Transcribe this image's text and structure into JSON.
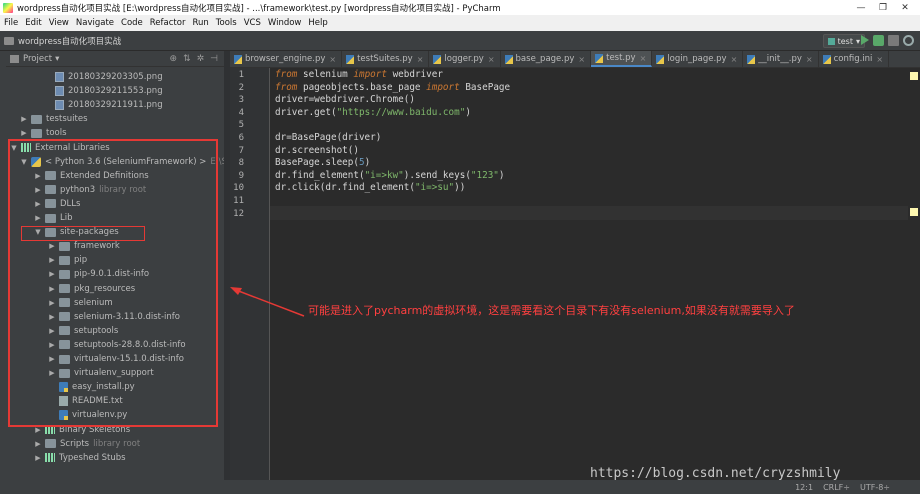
{
  "window": {
    "title": "wordpress自动化项目实战 [E:\\wordpress自动化项目实战] - ...\\framework\\test.py [wordpress自动化项目实战] - PyCharm",
    "controls": [
      "—",
      "❐",
      "✕"
    ]
  },
  "menu": [
    "File",
    "Edit",
    "View",
    "Navigate",
    "Code",
    "Refactor",
    "Run",
    "Tools",
    "VCS",
    "Window",
    "Help"
  ],
  "navbar": {
    "project_crumb": "wordpress自动化项目实战",
    "run_config": "test",
    "run_config_arrow": "▾"
  },
  "project_panel": {
    "title": "Project",
    "title_arrow": "▾",
    "tools": [
      "⊕",
      "⇅",
      "✲",
      "⊣"
    ]
  },
  "tree": [
    {
      "label": "20180329203305.png",
      "muted": "",
      "arrow": "",
      "type": "png",
      "indent": 34
    },
    {
      "label": "20180329211553.png",
      "muted": "",
      "arrow": "",
      "type": "png",
      "indent": 34
    },
    {
      "label": "20180329211911.png",
      "muted": "",
      "arrow": "",
      "type": "png",
      "indent": 34
    },
    {
      "label": "testsuites",
      "muted": "",
      "arrow": "▶",
      "type": "folder",
      "indent": 10
    },
    {
      "label": "tools",
      "muted": "",
      "arrow": "▶",
      "type": "folder",
      "indent": 10
    },
    {
      "label": "External Libraries",
      "muted": "",
      "arrow": "▼",
      "type": "lib",
      "indent": 0
    },
    {
      "label": "< Python 3.6 (SeleniumFramework) >",
      "muted": "E:\\Selenium",
      "arrow": "▼",
      "type": "python",
      "indent": 10
    },
    {
      "label": "Extended Definitions",
      "muted": "",
      "arrow": "▶",
      "type": "folder",
      "indent": 24
    },
    {
      "label": "python3",
      "muted": "library root",
      "arrow": "▶",
      "type": "folder",
      "indent": 24
    },
    {
      "label": "DLLs",
      "muted": "",
      "arrow": "▶",
      "type": "folder",
      "indent": 24
    },
    {
      "label": "Lib",
      "muted": "",
      "arrow": "▶",
      "type": "folder",
      "indent": 24
    },
    {
      "label": "site-packages",
      "muted": "",
      "arrow": "▼",
      "type": "folder",
      "indent": 24
    },
    {
      "label": "framework",
      "muted": "",
      "arrow": "▶",
      "type": "folder",
      "indent": 38
    },
    {
      "label": "pip",
      "muted": "",
      "arrow": "▶",
      "type": "folder",
      "indent": 38
    },
    {
      "label": "pip-9.0.1.dist-info",
      "muted": "",
      "arrow": "▶",
      "type": "folder",
      "indent": 38
    },
    {
      "label": "pkg_resources",
      "muted": "",
      "arrow": "▶",
      "type": "folder",
      "indent": 38
    },
    {
      "label": "selenium",
      "muted": "",
      "arrow": "▶",
      "type": "folder",
      "indent": 38
    },
    {
      "label": "selenium-3.11.0.dist-info",
      "muted": "",
      "arrow": "▶",
      "type": "folder",
      "indent": 38
    },
    {
      "label": "setuptools",
      "muted": "",
      "arrow": "▶",
      "type": "folder",
      "indent": 38
    },
    {
      "label": "setuptools-28.8.0.dist-info",
      "muted": "",
      "arrow": "▶",
      "type": "folder",
      "indent": 38
    },
    {
      "label": "virtualenv-15.1.0.dist-info",
      "muted": "",
      "arrow": "▶",
      "type": "folder",
      "indent": 38
    },
    {
      "label": "virtualenv_support",
      "muted": "",
      "arrow": "▶",
      "type": "folder",
      "indent": 38
    },
    {
      "label": "easy_install.py",
      "muted": "",
      "arrow": "",
      "type": "py",
      "indent": 38
    },
    {
      "label": "README.txt",
      "muted": "",
      "arrow": "",
      "type": "txt",
      "indent": 38
    },
    {
      "label": "virtualenv.py",
      "muted": "",
      "arrow": "",
      "type": "py",
      "indent": 38
    },
    {
      "label": "Binary Skeletons",
      "muted": "",
      "arrow": "▶",
      "type": "lib",
      "indent": 24
    },
    {
      "label": "Scripts",
      "muted": "library root",
      "arrow": "▶",
      "type": "folder",
      "indent": 24
    },
    {
      "label": "Typeshed Stubs",
      "muted": "",
      "arrow": "▶",
      "type": "lib",
      "indent": 24
    }
  ],
  "tabs": [
    {
      "label": "browser_engine.py",
      "active": false
    },
    {
      "label": "testSuites.py",
      "active": false
    },
    {
      "label": "logger.py",
      "active": false
    },
    {
      "label": "base_page.py",
      "active": false
    },
    {
      "label": "test.py",
      "active": true
    },
    {
      "label": "login_page.py",
      "active": false
    },
    {
      "label": "__init__.py",
      "active": false
    },
    {
      "label": "config.ini",
      "active": false
    }
  ],
  "code_lines": [
    [
      [
        "kw",
        "from"
      ],
      [
        "id",
        " selenium "
      ],
      [
        "kw",
        "import"
      ],
      [
        "id",
        " webdriver"
      ]
    ],
    [
      [
        "kw",
        "from"
      ],
      [
        "id",
        " pageobjects.base_page "
      ],
      [
        "kw",
        "import"
      ],
      [
        "id",
        " BasePage"
      ]
    ],
    [
      [
        "id",
        "driver=webdriver.Chrome()"
      ]
    ],
    [
      [
        "id",
        "driver.get("
      ],
      [
        "st",
        "\"https://www.baidu.com\""
      ],
      [
        "id",
        ")"
      ]
    ],
    [],
    [
      [
        "id",
        "dr=BasePage(driver)"
      ]
    ],
    [
      [
        "id",
        "dr.screenshot()"
      ]
    ],
    [
      [
        "id",
        "BasePage.sleep("
      ],
      [
        "nm",
        "5"
      ],
      [
        "id",
        ")"
      ]
    ],
    [
      [
        "id",
        "dr.find_element("
      ],
      [
        "st",
        "\"i=>kw\""
      ],
      [
        "id",
        ").send_keys("
      ],
      [
        "st",
        "\"123\""
      ],
      [
        "id",
        ")"
      ]
    ],
    [
      [
        "id",
        "dr.click(dr.find_element("
      ],
      [
        "st",
        "\"i=>su\""
      ],
      [
        "id",
        "))"
      ]
    ],
    [],
    []
  ],
  "annotation": "可能是进入了pycharm的虚拟环境，这是需要看这个目录下有没有selenium,如果没有就需要导入了",
  "watermark": "https://blog.csdn.net/cryzshmily",
  "status": {
    "position": "12:1",
    "line_sep": "CRLF÷",
    "encoding": "UTF-8÷"
  },
  "colors": {
    "annotation": "#ff4040",
    "highlight_box": "#e53935",
    "active_tab_underline": "#4a88c7"
  }
}
